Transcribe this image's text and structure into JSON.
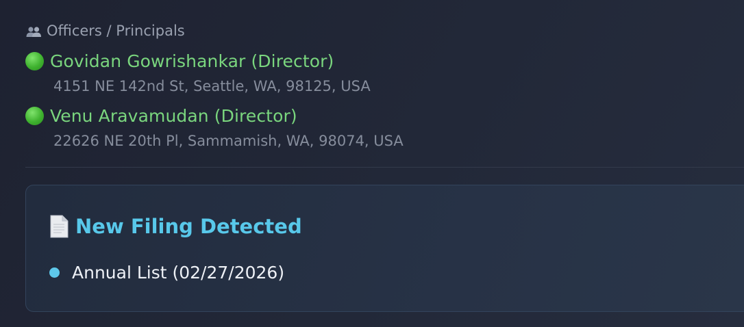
{
  "officers_section": {
    "title": "Officers / Principals",
    "icon": "people-icon",
    "officers": [
      {
        "name": "Govidan Gowrishankar (Director)",
        "address": "4151 NE 142nd St, Seattle, WA, 98125, USA",
        "status_color": "#3fb22f"
      },
      {
        "name": "Venu Aravamudan (Director)",
        "address": "22626 NE 20th Pl, Sammamish, WA, 98074, USA",
        "status_color": "#3fb22f"
      }
    ]
  },
  "filing_alert": {
    "icon": "document-icon",
    "title": "New Filing Detected",
    "items": [
      "Annual List (02/27/2026)"
    ],
    "accent_color": "#58c8ea"
  }
}
